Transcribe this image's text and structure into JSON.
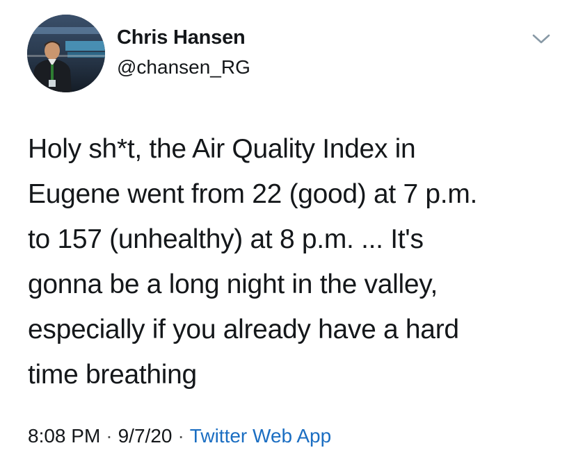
{
  "author": {
    "name": "Chris Hansen",
    "handle": "@chansen_RG",
    "avatar_icon": "profile-photo"
  },
  "menu": {
    "icon": "chevron-down-icon"
  },
  "tweet": {
    "text": "Holy sh*t, the Air Quality Index in\nEugene went from 22 (good) at 7 p.m.\nto 157 (unhealthy) at 8 p.m. ... It's\ngonna be a long night in the valley,\nespecially if you already have a hard\ntime breathing"
  },
  "meta": {
    "time": "8:08 PM",
    "date": "9/7/20",
    "separator": "·",
    "source": "Twitter Web App"
  },
  "colors": {
    "text": "#14171a",
    "link": "#1b6ec2",
    "icon": "#8899a6"
  }
}
